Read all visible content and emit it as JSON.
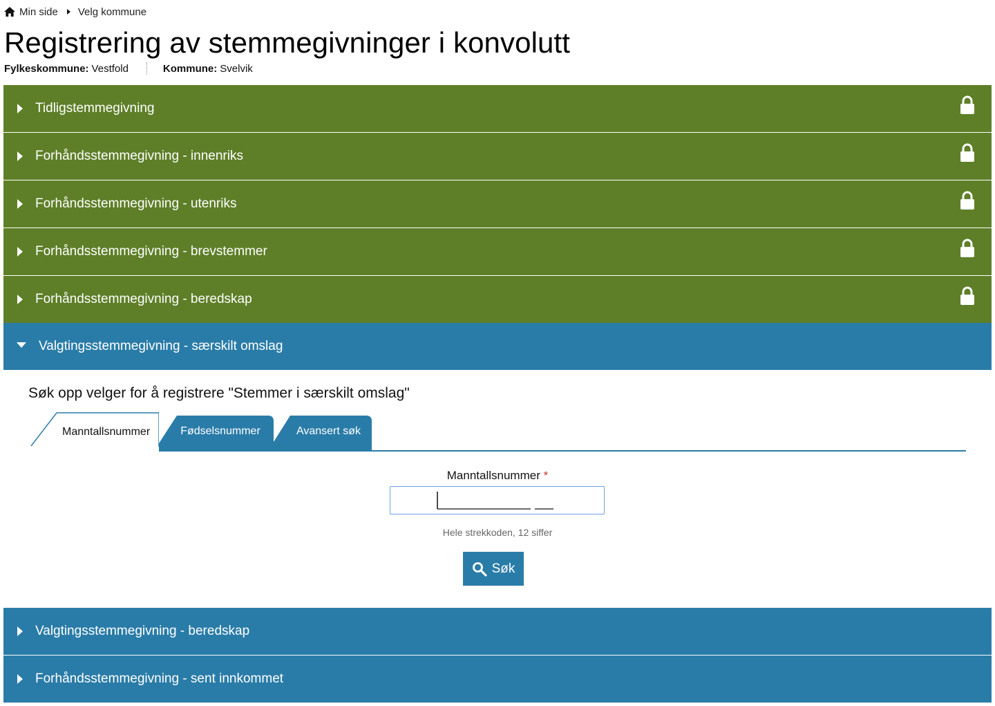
{
  "breadcrumb": {
    "home_label": "Min side",
    "current_label": "Velg kommune"
  },
  "header": {
    "title": "Registrering av stemmegivninger i konvolutt",
    "county_key": "Fylkeskommune:",
    "county_value": "Vestfold",
    "municipality_key": "Kommune:",
    "municipality_value": "Svelvik"
  },
  "accordion": {
    "items": [
      {
        "label": "Tidligstemmegivning",
        "locked": true,
        "color": "#5e7f28"
      },
      {
        "label": "Forhåndsstemmegivning - innenriks",
        "locked": true,
        "color": "#5e7f28"
      },
      {
        "label": "Forhåndsstemmegivning - utenriks",
        "locked": true,
        "color": "#5e7f28"
      },
      {
        "label": "Forhåndsstemmegivning - brevstemmer",
        "locked": true,
        "color": "#5e7f28"
      },
      {
        "label": "Forhåndsstemmegivning - beredskap",
        "locked": true,
        "color": "#5e7f28"
      },
      {
        "label": "Valgtingsstemmegivning - særskilt omslag",
        "expanded": true,
        "color": "#2a7ca8"
      },
      {
        "label": "Valgtingsstemmegivning - beredskap",
        "color": "#2a7ca8"
      },
      {
        "label": "Forhåndsstemmegivning - sent innkommet",
        "color": "#2a7ca8"
      }
    ]
  },
  "search": {
    "heading": "Søk opp velger for å registrere \"Stemmer i særskilt omslag\"",
    "tabs": [
      {
        "label": "Manntallsnummer",
        "active": true
      },
      {
        "label": "Fødselsnummer"
      },
      {
        "label": "Avansert søk"
      }
    ],
    "field_label": "Manntallsnummer",
    "required_marker": "*",
    "input_value": "",
    "hint": "Hele strekkoden, 12 siffer",
    "button_label": "Søk"
  },
  "colors": {
    "green": "#5e7f28",
    "blue": "#2a7ca8",
    "input_border": "#6ea0e0"
  }
}
